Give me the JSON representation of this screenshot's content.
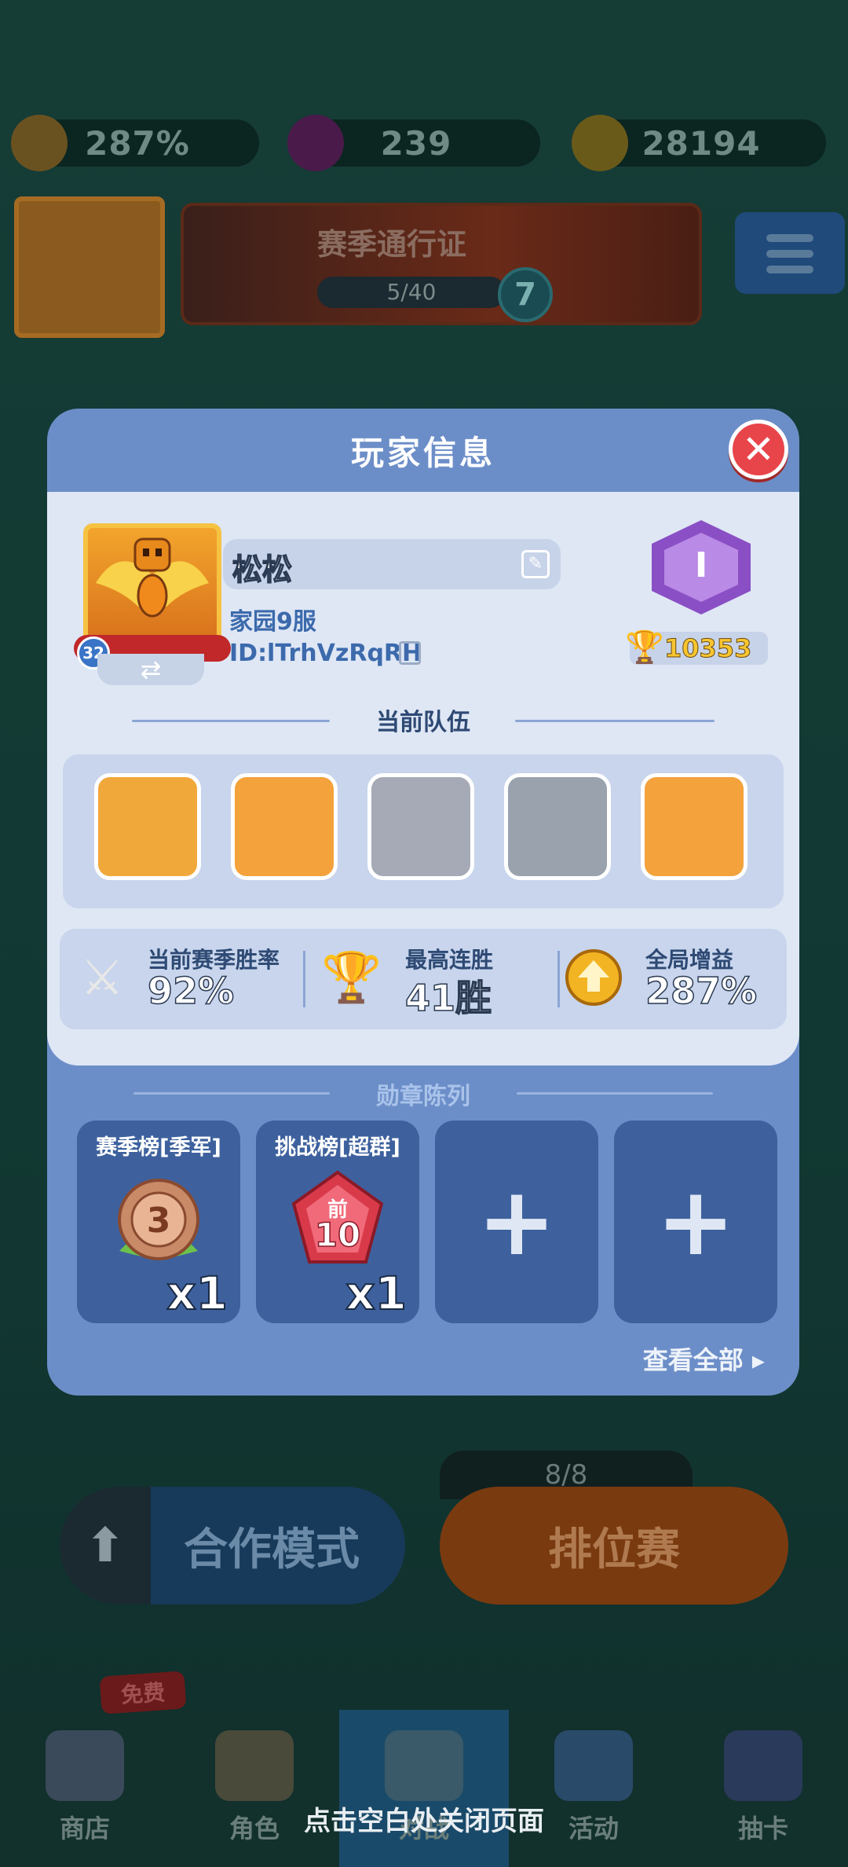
{
  "background": {
    "resources": [
      {
        "name": "boost",
        "value": "287%"
      },
      {
        "name": "gems",
        "value": "239"
      },
      {
        "name": "coins",
        "value": "28194"
      }
    ],
    "season_pass": {
      "title": "赛季通行证",
      "progress": "5/40",
      "level": "7"
    },
    "avatar_level": "32",
    "modes": {
      "coop": "合作模式",
      "ranked": "排位赛",
      "ranked_tickets": "8/8"
    },
    "nav": {
      "free_badge": "免费",
      "items": [
        {
          "label": "商店"
        },
        {
          "label": "角色"
        },
        {
          "label": "对战"
        },
        {
          "label": "活动"
        },
        {
          "label": "抽卡"
        }
      ]
    },
    "close_hint": "点击空白处关闭页面"
  },
  "modal": {
    "title": "玩家信息",
    "player": {
      "name": "松松",
      "server": "家园9服",
      "id": "ID:lTrhVzRqRH",
      "level": "32",
      "rank_tier": "I",
      "trophies": "10353"
    },
    "team": {
      "title": "当前队伍",
      "heroes": [
        {
          "name": "king-hero",
          "color": "#f1a83a"
        },
        {
          "name": "dark-knight-hero",
          "color": "#f3a23c"
        },
        {
          "name": "ghost-archer-hero",
          "color": "#a5aab6"
        },
        {
          "name": "warrior-hero",
          "color": "#9aa2ae"
        },
        {
          "name": "angel-hero",
          "color": "#f3a23c"
        }
      ]
    },
    "stats": [
      {
        "label": "当前赛季胜率",
        "value": "92%",
        "icon": "crossed-swords-icon"
      },
      {
        "label": "最高连胜",
        "value": "41胜",
        "icon": "trophy-icon"
      },
      {
        "label": "全局增益",
        "value": "287%",
        "icon": "boost-icon"
      }
    ],
    "medals": {
      "title": "勋章陈列",
      "items": [
        {
          "name": "赛季榜[季军]",
          "count": "x1",
          "icon": "bronze-medal-3-icon",
          "badge_text": "3"
        },
        {
          "name": "挑战榜[超群]",
          "count": "x1",
          "icon": "top10-badge-icon",
          "badge_top": "前",
          "badge_text": "10"
        },
        {
          "name": "",
          "count": "",
          "icon": "plus-icon"
        },
        {
          "name": "",
          "count": "",
          "icon": "plus-icon"
        }
      ],
      "view_all": "查看全部 ▸"
    }
  }
}
